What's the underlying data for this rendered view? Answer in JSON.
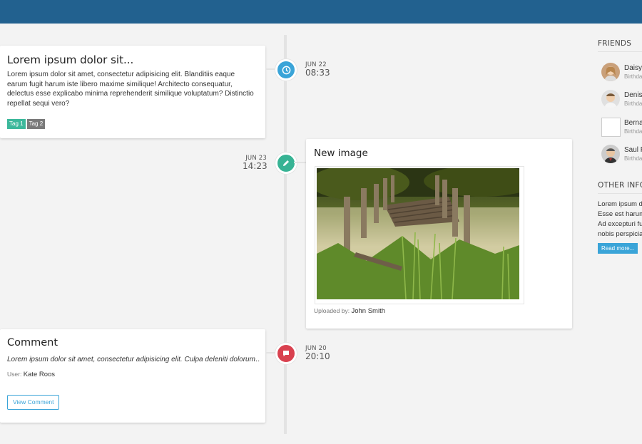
{
  "timeline": {
    "items": [
      {
        "title": "Lorem ipsum dolor sit...",
        "body": "Lorem ipsum dolor sit amet, consectetur adipisicing elit. Blanditiis eaque earum fugit harum iste libero maxime similique! Architecto consequatur, delectus esse explicabo minima reprehenderit similique voluptatum? Distinctio repellat sequi vero?",
        "tags": [
          "Tag 1",
          "Tag 2"
        ],
        "tag_colors": [
          "#3cb89b",
          "#7a7a7a"
        ],
        "date": "JUN 22",
        "time": "08:33",
        "icon": "clock-icon",
        "icon_color": "#3aa4d8"
      },
      {
        "title": "New image",
        "uploaded_label": "Uploaded by:",
        "uploaded_by": "John Smith",
        "date": "JUN 23",
        "time": "14:23",
        "icon": "pencil-icon",
        "icon_color": "#37b394"
      },
      {
        "title": "Comment",
        "body": "Lorem ipsum dolor sit amet, consectetur adipisicing elit. Culpa deleniti dolorum…",
        "user_label": "User:",
        "user": "Kate Roos",
        "button": "View Comment",
        "date": "JUN 20",
        "time": "20:10",
        "icon": "comment-icon",
        "icon_color": "#d9414f"
      }
    ]
  },
  "sidebar": {
    "friends_title": "FRIENDS",
    "friends": [
      {
        "name": "Daisy",
        "sub": "Birthda"
      },
      {
        "name": "Denis",
        "sub": "Birthda"
      },
      {
        "name": "Berna",
        "sub": "Birthda"
      },
      {
        "name": "Saul F",
        "sub": "Birthda"
      }
    ],
    "other_title": "OTHER INFO",
    "other_lines": [
      "Lorem ipsum d",
      "Esse est harum",
      "Ad excepturi fu",
      "nobis perspicia"
    ],
    "read_more": "Read more..."
  }
}
